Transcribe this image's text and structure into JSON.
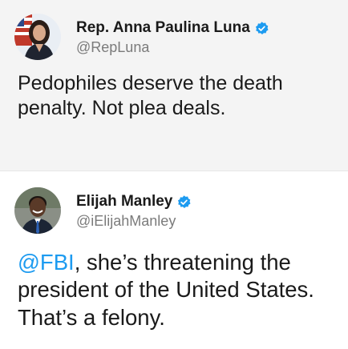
{
  "colors": {
    "verified_badge": "#1d9bf0",
    "mention": "#1d9bf0",
    "name": "#1a1a1a",
    "handle": "#7b7b7b",
    "top_background": "#f4f4f4"
  },
  "tweets": [
    {
      "display_name": "Rep. Anna Paulina Luna",
      "handle": "@RepLuna",
      "verified_icon": "verified-badge-icon",
      "text": "Pedophiles deserve the death penalty. Not plea deals."
    },
    {
      "display_name": "Elijah Manley",
      "handle": "@iElijahManley",
      "verified_icon": "verified-badge-icon",
      "mention": "@FBI",
      "text_rest": ", she’s threatening the president of the United States. That’s a felony."
    }
  ]
}
